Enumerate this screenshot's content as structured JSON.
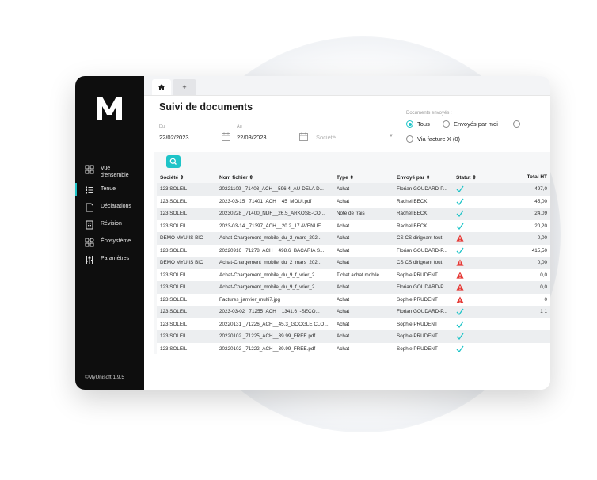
{
  "sidebar": {
    "items": [
      {
        "label_line1": "Vue",
        "label_line2": "d'ensemble",
        "icon": "grid-icon"
      },
      {
        "label_line1": "Tenue",
        "label_line2": "",
        "icon": "list-icon"
      },
      {
        "label_line1": "Déclarations",
        "label_line2": "",
        "icon": "document-icon"
      },
      {
        "label_line1": "Révision",
        "label_line2": "",
        "icon": "building-icon"
      },
      {
        "label_line1": "Écosystème",
        "label_line2": "",
        "icon": "ecosystem-icon"
      },
      {
        "label_line1": "Paramètres",
        "label_line2": "",
        "icon": "sliders-icon"
      }
    ],
    "version": "©MyUnisoft 1.9.5"
  },
  "tabs": {
    "home_icon": "home-icon",
    "add_label": "+"
  },
  "page": {
    "title": "Suivi de documents"
  },
  "filters": {
    "from_label": "Du",
    "from_value": "22/02/2023",
    "to_label": "Au",
    "to_value": "22/03/2023",
    "societe_placeholder": "Société",
    "docs_label": "Documents envoyés :",
    "radio_all": "Tous",
    "radio_par_moi": "Envoyés par moi",
    "radio_facture_x": "Via facture X (0)"
  },
  "table": {
    "headers": {
      "societe": "Société ⇕",
      "fichier": "Nom fichier ⇕",
      "type": "Type ⇕",
      "envoye": "Envoyé par ⇕",
      "statut": "Statut ⇕",
      "total": "Total HT"
    },
    "rows": [
      {
        "societe": "123 SOLEIL",
        "fichier": "20221109 _71403_ACH__596.4_AU-DELA D...",
        "type": "Achat",
        "envoye": "Florian GOUDARD-P...",
        "statut": "check",
        "total": "497,0"
      },
      {
        "societe": "123 SOLEIL",
        "fichier": "2023-03-15 _71401_ACH__45_MOUI.pdf",
        "type": "Achat",
        "envoye": "Rachel BECK",
        "statut": "check",
        "total": "45,00"
      },
      {
        "societe": "123 SOLEIL",
        "fichier": "20230228 _71400_NDF__26.5_ARKOSE-CO...",
        "type": "Note de frais",
        "envoye": "Rachel BECK",
        "statut": "check",
        "total": "24,09"
      },
      {
        "societe": "123 SOLEIL",
        "fichier": "2023-03-14 _71397_ACH__20.2_17 AVENUE...",
        "type": "Achat",
        "envoye": "Rachel BECK",
        "statut": "check",
        "total": "20,20"
      },
      {
        "societe": "DEMO MYU IS BIC",
        "fichier": "Achat-Chargement_mobile_du_2_mars_202...",
        "type": "Achat",
        "envoye": "CS CS dirigeant tout",
        "statut": "warning",
        "total": "0,00"
      },
      {
        "societe": "123 SOLEIL",
        "fichier": "20220916 _71278_ACH__498.6_BACARIA S...",
        "type": "Achat",
        "envoye": "Florian GOUDARD-P...",
        "statut": "check",
        "total": "415,50"
      },
      {
        "societe": "DEMO MYU IS BIC",
        "fichier": "Achat-Chargement_mobile_du_2_mars_202...",
        "type": "Achat",
        "envoye": "CS CS dirigeant tout",
        "statut": "warning",
        "total": "0,00"
      },
      {
        "societe": "123 SOLEIL",
        "fichier": "Achat-Chargement_mobile_du_9_f_vrier_2...",
        "type": "Ticket achat mobile",
        "envoye": "Sophie PRUDENT",
        "statut": "warning",
        "total": "0,0"
      },
      {
        "societe": "123 SOLEIL",
        "fichier": "Achat-Chargement_mobile_du_9_f_vrier_2...",
        "type": "Achat",
        "envoye": "Florian GOUDARD-P...",
        "statut": "warning",
        "total": "0,0"
      },
      {
        "societe": "123 SOLEIL",
        "fichier": "Factures_janvier_multi7.jpg",
        "type": "Achat",
        "envoye": "Sophie PRUDENT",
        "statut": "warning",
        "total": "0"
      },
      {
        "societe": "123 SOLEIL",
        "fichier": "2023-03-02 _71255_ACH__1341.6_-SECO...",
        "type": "Achat",
        "envoye": "Florian GOUDARD-P...",
        "statut": "check",
        "total": "1 1"
      },
      {
        "societe": "123 SOLEIL",
        "fichier": "20220131 _71226_ACH__45.3_GOOGLE CLO...",
        "type": "Achat",
        "envoye": "Sophie PRUDENT",
        "statut": "check",
        "total": ""
      },
      {
        "societe": "123 SOLEIL",
        "fichier": "20220102 _71225_ACH__39.99_FREE.pdf",
        "type": "Achat",
        "envoye": "Sophie PRUDENT",
        "statut": "check",
        "total": ""
      },
      {
        "societe": "123 SOLEIL",
        "fichier": "20220102 _71222_ACH__39.99_FREE.pdf",
        "type": "Achat",
        "envoye": "Sophie PRUDENT",
        "statut": "check",
        "total": ""
      }
    ]
  },
  "colors": {
    "accent": "#1ec4c8",
    "warning": "#e53935",
    "sidebar": "#0e0e0e"
  }
}
